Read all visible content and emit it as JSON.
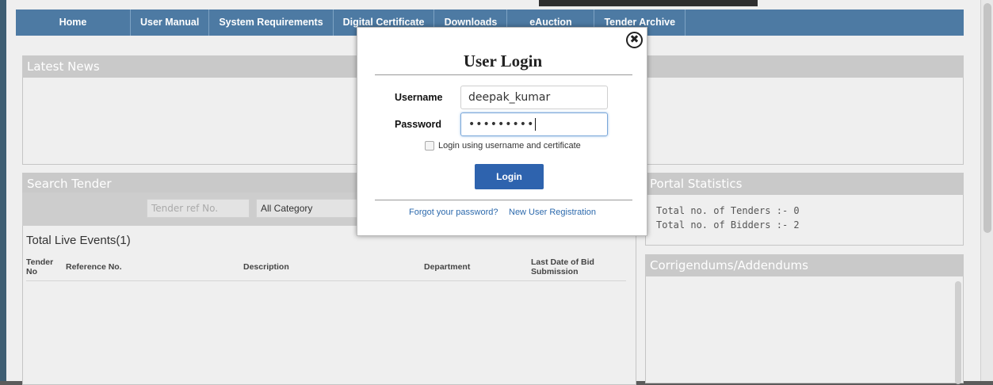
{
  "nav": {
    "items": [
      "Home",
      "User Manual",
      "System Requirements",
      "Digital Certificate",
      "Downloads",
      "eAuction",
      "Tender Archive"
    ]
  },
  "panels": {
    "latest_news": "Latest News",
    "search_tender": "Search Tender",
    "portal_statistics": "Portal Statistics",
    "corrigendums": "Corrigendums/Addendums"
  },
  "search": {
    "tender_ref_placeholder": "Tender ref No.",
    "category_selected": "All Category"
  },
  "events": {
    "title": "Total Live Events(1)",
    "columns": {
      "tender_no": "Tender No",
      "reference_no": "Reference No.",
      "description": "Description",
      "department": "Department",
      "last_date": "Last Date of Bid Submission"
    }
  },
  "stats": {
    "tenders": "Total no. of Tenders :- 0",
    "bidders": "Total no. of Bidders :- 2"
  },
  "modal": {
    "title": "User Login",
    "username_label": "Username",
    "username_value": "deepak_kumar",
    "password_label": "Password",
    "password_mask": "•••••••••",
    "checkbox_label": "Login using username and certificate",
    "login_button": "Login",
    "forgot_link": "Forgot your password?",
    "register_link": "New User Registration",
    "close_glyph": "✖"
  },
  "colors": {
    "nav_bg": "#4d7aa3",
    "panel_header": "#c9c9c9",
    "login_button": "#2e63ae",
    "link": "#2d6aad"
  }
}
